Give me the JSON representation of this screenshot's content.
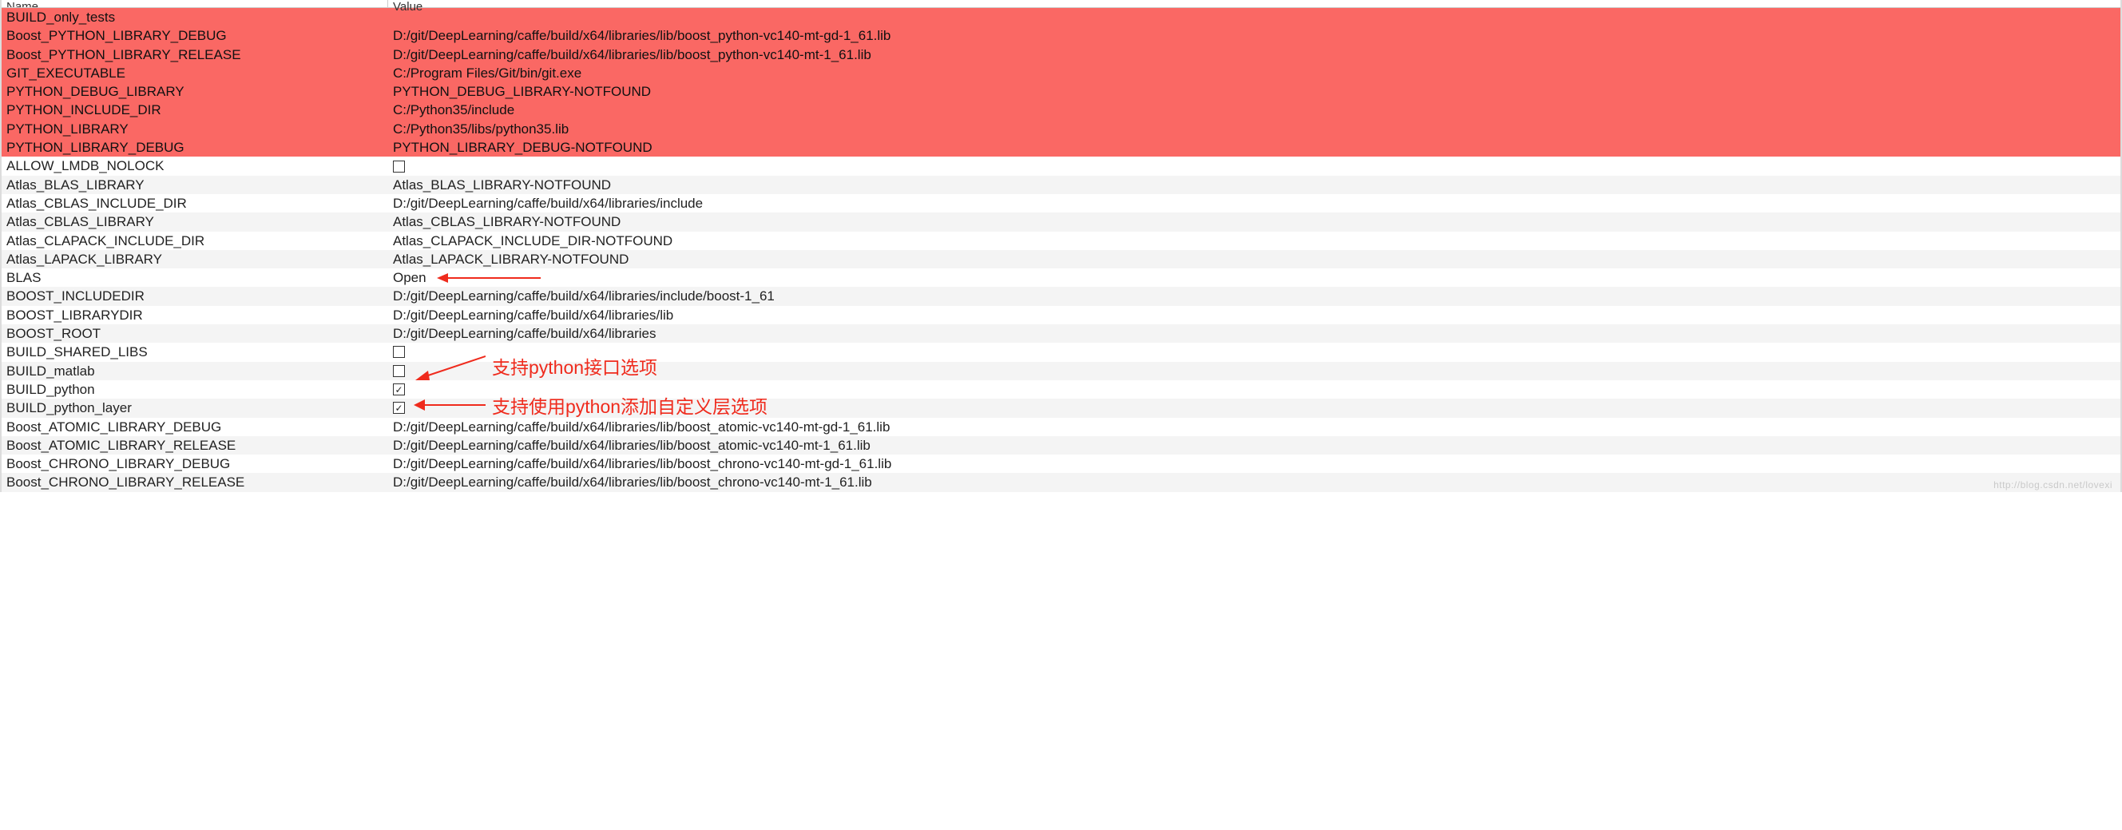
{
  "headers": {
    "name": "Name",
    "value": "Value"
  },
  "watermark": "http://blog.csdn.net/lovexi",
  "annotations": {
    "a1": "支持python接口选项",
    "a2": "支持使用python添加自定义层选项"
  },
  "rows": [
    {
      "name": "BUILD_only_tests",
      "type": "text",
      "value": "",
      "new": true
    },
    {
      "name": "Boost_PYTHON_LIBRARY_DEBUG",
      "type": "text",
      "value": "D:/git/DeepLearning/caffe/build/x64/libraries/lib/boost_python-vc140-mt-gd-1_61.lib",
      "new": true
    },
    {
      "name": "Boost_PYTHON_LIBRARY_RELEASE",
      "type": "text",
      "value": "D:/git/DeepLearning/caffe/build/x64/libraries/lib/boost_python-vc140-mt-1_61.lib",
      "new": true
    },
    {
      "name": "GIT_EXECUTABLE",
      "type": "text",
      "value": "C:/Program Files/Git/bin/git.exe",
      "new": true
    },
    {
      "name": "PYTHON_DEBUG_LIBRARY",
      "type": "text",
      "value": "PYTHON_DEBUG_LIBRARY-NOTFOUND",
      "new": true
    },
    {
      "name": "PYTHON_INCLUDE_DIR",
      "type": "text",
      "value": "C:/Python35/include",
      "new": true
    },
    {
      "name": "PYTHON_LIBRARY",
      "type": "text",
      "value": "C:/Python35/libs/python35.lib",
      "new": true
    },
    {
      "name": "PYTHON_LIBRARY_DEBUG",
      "type": "text",
      "value": "PYTHON_LIBRARY_DEBUG-NOTFOUND",
      "new": true
    },
    {
      "name": "ALLOW_LMDB_NOLOCK",
      "type": "bool",
      "value": false,
      "new": false
    },
    {
      "name": "Atlas_BLAS_LIBRARY",
      "type": "text",
      "value": "Atlas_BLAS_LIBRARY-NOTFOUND",
      "new": false
    },
    {
      "name": "Atlas_CBLAS_INCLUDE_DIR",
      "type": "text",
      "value": "D:/git/DeepLearning/caffe/build/x64/libraries/include",
      "new": false
    },
    {
      "name": "Atlas_CBLAS_LIBRARY",
      "type": "text",
      "value": "Atlas_CBLAS_LIBRARY-NOTFOUND",
      "new": false
    },
    {
      "name": "Atlas_CLAPACK_INCLUDE_DIR",
      "type": "text",
      "value": "Atlas_CLAPACK_INCLUDE_DIR-NOTFOUND",
      "new": false
    },
    {
      "name": "Atlas_LAPACK_LIBRARY",
      "type": "text",
      "value": "Atlas_LAPACK_LIBRARY-NOTFOUND",
      "new": false
    },
    {
      "name": "BLAS",
      "type": "text",
      "value": "Open",
      "new": false
    },
    {
      "name": "BOOST_INCLUDEDIR",
      "type": "text",
      "value": "D:/git/DeepLearning/caffe/build/x64/libraries/include/boost-1_61",
      "new": false
    },
    {
      "name": "BOOST_LIBRARYDIR",
      "type": "text",
      "value": "D:/git/DeepLearning/caffe/build/x64/libraries/lib",
      "new": false
    },
    {
      "name": "BOOST_ROOT",
      "type": "text",
      "value": "D:/git/DeepLearning/caffe/build/x64/libraries",
      "new": false
    },
    {
      "name": "BUILD_SHARED_LIBS",
      "type": "bool",
      "value": false,
      "new": false
    },
    {
      "name": "BUILD_matlab",
      "type": "bool",
      "value": false,
      "new": false
    },
    {
      "name": "BUILD_python",
      "type": "bool",
      "value": true,
      "new": false
    },
    {
      "name": "BUILD_python_layer",
      "type": "bool",
      "value": true,
      "new": false
    },
    {
      "name": "Boost_ATOMIC_LIBRARY_DEBUG",
      "type": "text",
      "value": "D:/git/DeepLearning/caffe/build/x64/libraries/lib/boost_atomic-vc140-mt-gd-1_61.lib",
      "new": false
    },
    {
      "name": "Boost_ATOMIC_LIBRARY_RELEASE",
      "type": "text",
      "value": "D:/git/DeepLearning/caffe/build/x64/libraries/lib/boost_atomic-vc140-mt-1_61.lib",
      "new": false
    },
    {
      "name": "Boost_CHRONO_LIBRARY_DEBUG",
      "type": "text",
      "value": "D:/git/DeepLearning/caffe/build/x64/libraries/lib/boost_chrono-vc140-mt-gd-1_61.lib",
      "new": false
    },
    {
      "name": "Boost_CHRONO_LIBRARY_RELEASE",
      "type": "text",
      "value": "D:/git/DeepLearning/caffe/build/x64/libraries/lib/boost_chrono-vc140-mt-1_61.lib",
      "new": false
    }
  ]
}
